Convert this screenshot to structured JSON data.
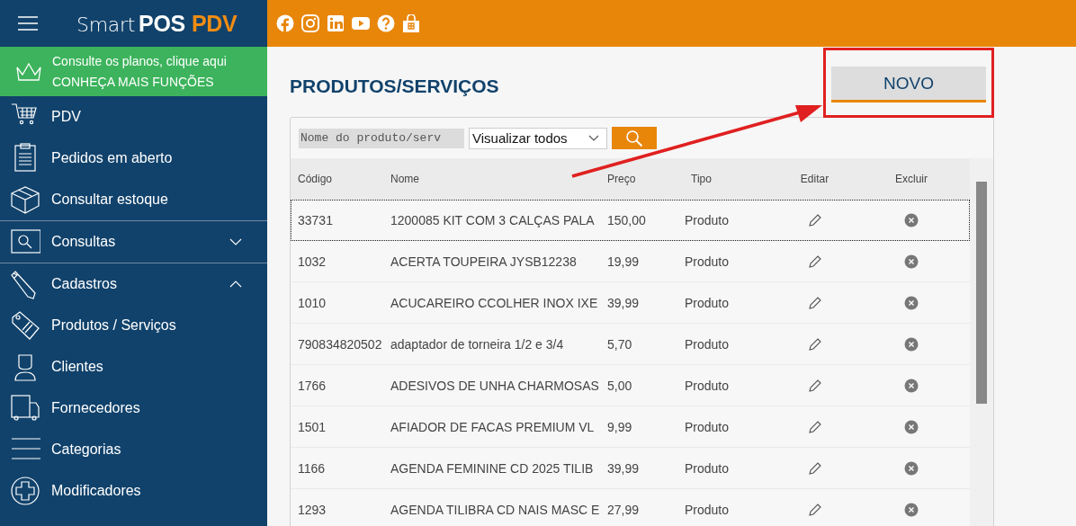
{
  "logo": {
    "part_1": "Smart",
    "part_2": "POS",
    "part_3": "PDV"
  },
  "promo": {
    "line_1": "Consulte os planos, clique aqui",
    "line_2": "CONHEÇA MAIS FUNÇÕES"
  },
  "sidebar": {
    "items": [
      {
        "label": "PDV",
        "kind": "link"
      },
      {
        "label": "Pedidos em aberto",
        "kind": "link"
      },
      {
        "label": "Consultar estoque",
        "kind": "link"
      },
      {
        "label": "Consultas",
        "kind": "group",
        "expanded": false
      },
      {
        "label": "Cadastros",
        "kind": "group",
        "expanded": true
      },
      {
        "label": "Produtos / Serviços",
        "kind": "link"
      },
      {
        "label": "Clientes",
        "kind": "link"
      },
      {
        "label": "Fornecedores",
        "kind": "link"
      },
      {
        "label": "Categorias",
        "kind": "link"
      },
      {
        "label": "Modificadores",
        "kind": "link"
      }
    ]
  },
  "page_title": "PRODUTOS/SERVIÇOS",
  "new_button": "NOVO",
  "annotation": {
    "highlight_box": true,
    "arrow": true
  },
  "filters": {
    "search": {
      "placeholder": "Nome do produto/serv"
    },
    "view_select": "Visualizar todos"
  },
  "table": {
    "columns": [
      "Código",
      "Nome",
      "Preço",
      "Tipo",
      "Editar",
      "Excluir"
    ],
    "rows": [
      {
        "code": "33731",
        "name": "1200085 KIT COM 3 CALÇAS PALA",
        "price": "150,00",
        "type": "Produto",
        "selected": true
      },
      {
        "code": "1032",
        "name": "ACERTA TOUPEIRA JYSB12238",
        "price": "19,99",
        "type": "Produto",
        "selected": false
      },
      {
        "code": "1010",
        "name": "ACUCAREIRO CCOLHER INOX IXE",
        "price": "39,99",
        "type": "Produto",
        "selected": false
      },
      {
        "code": "790834820502",
        "name": "adaptador de torneira 1/2 e 3/4",
        "price": "5,70",
        "type": "Produto",
        "selected": false
      },
      {
        "code": "1766",
        "name": "ADESIVOS DE UNHA CHARMOSAS",
        "price": "5,00",
        "type": "Produto",
        "selected": false
      },
      {
        "code": "1501",
        "name": "AFIADOR DE FACAS PREMIUM VL",
        "price": "9,99",
        "type": "Produto",
        "selected": false
      },
      {
        "code": "1166",
        "name": "AGENDA FEMININE CD 2025 TILIB",
        "price": "39,99",
        "type": "Produto",
        "selected": false
      },
      {
        "code": "1293",
        "name": "AGENDA TILIBRA CD NAIS MASC E",
        "price": "27,99",
        "type": "Produto",
        "selected": false
      }
    ]
  }
}
